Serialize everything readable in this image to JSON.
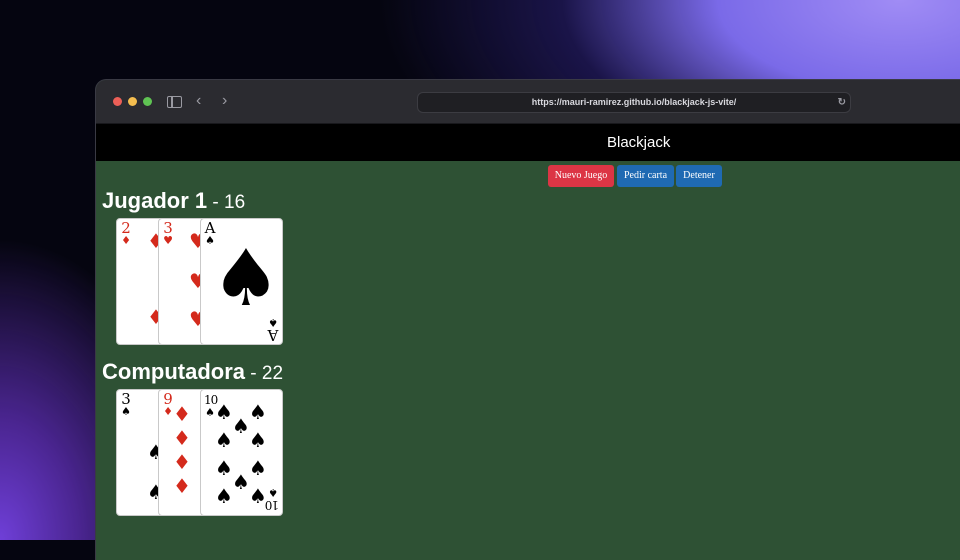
{
  "browser": {
    "url": "https://mauri-ramirez.github.io/blackjack-js-vite/"
  },
  "navbar": {
    "brand": "Blackjack"
  },
  "buttons": {
    "new_game": "Nuevo Juego",
    "hit": "Pedir carta",
    "stand": "Detener"
  },
  "player": {
    "name": "Jugador 1",
    "separator": " - ",
    "score": "16",
    "cards": [
      {
        "rank": "2",
        "suit": "♦",
        "color": "red"
      },
      {
        "rank": "3",
        "suit": "♥",
        "color": "red"
      },
      {
        "rank": "A",
        "suit": "♠",
        "color": "black"
      }
    ]
  },
  "computer": {
    "name": "Computadora",
    "separator": " - ",
    "score": "22",
    "cards": [
      {
        "rank": "3",
        "suit": "♠",
        "color": "black"
      },
      {
        "rank": "9",
        "suit": "♦",
        "color": "red"
      },
      {
        "rank": "10",
        "suit": "♠",
        "color": "black"
      }
    ]
  },
  "colors": {
    "table_green": "#2e5134",
    "danger": "#dc3545",
    "primary": "#1f6ab3"
  }
}
